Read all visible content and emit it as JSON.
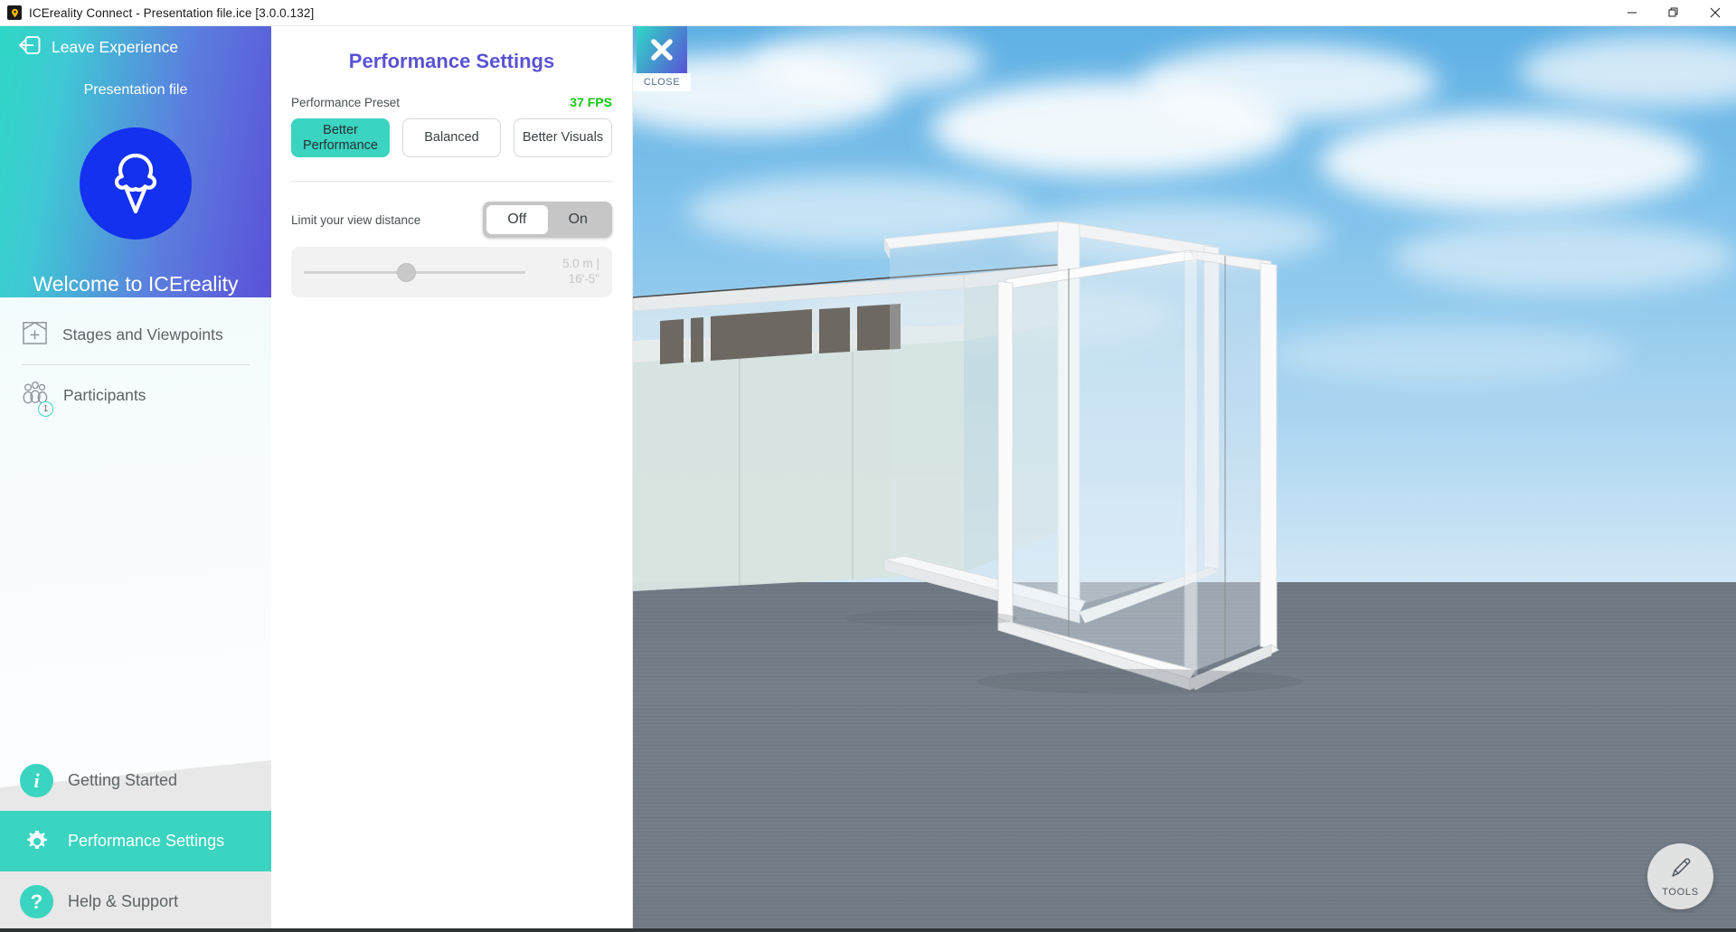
{
  "window": {
    "title": "ICEreality Connect - Presentation file.ice [3.0.0.132]",
    "app_icon": "location-pin-icon",
    "minimize_label": "Minimize",
    "restore_label": "Restore",
    "close_label": "Close"
  },
  "sidebar": {
    "leave_experience": "Leave Experience",
    "presentation_file": "Presentation file",
    "welcome": "Welcome to ICEreality",
    "logo_icon": "ice-cream-cone-icon",
    "nav": [
      {
        "label": "Stages and Viewpoints",
        "icon": "add-stage-icon",
        "badge": ""
      },
      {
        "label": "Participants",
        "icon": "participants-icon",
        "badge": "1"
      }
    ],
    "bottom": [
      {
        "label": "Getting Started",
        "icon": "info-icon",
        "glyph": "i",
        "active": false
      },
      {
        "label": "Performance Settings",
        "icon": "gear-icon",
        "glyph": "",
        "active": true
      },
      {
        "label": "Help & Support",
        "icon": "question-icon",
        "glyph": "?",
        "active": false
      }
    ]
  },
  "panel": {
    "title": "Performance Settings",
    "preset_label": "Performance Preset",
    "fps": "37 FPS",
    "presets": [
      {
        "label": "Better Performance",
        "selected": true
      },
      {
        "label": "Balanced",
        "selected": false
      },
      {
        "label": "Better Visuals",
        "selected": false
      }
    ],
    "view_distance_label": "Limit your view distance",
    "toggle": {
      "off": "Off",
      "on": "On",
      "selected": "Off"
    },
    "slider": {
      "value_metric": "5.0 m |",
      "value_imperial": "16'-5\"",
      "position_pct": 46,
      "enabled": false
    }
  },
  "viewport": {
    "close_label": "CLOSE",
    "close_icon": "x-icon",
    "tools_label": "TOOLS",
    "tools_icon": "pencil-icon",
    "scene_description": "3D architectural glass partition walls with sky background"
  },
  "colors": {
    "accent_teal": "#3ad4c0",
    "accent_purple": "#5a52d5",
    "fps_green": "#12c712",
    "logo_blue": "#1431ef"
  }
}
